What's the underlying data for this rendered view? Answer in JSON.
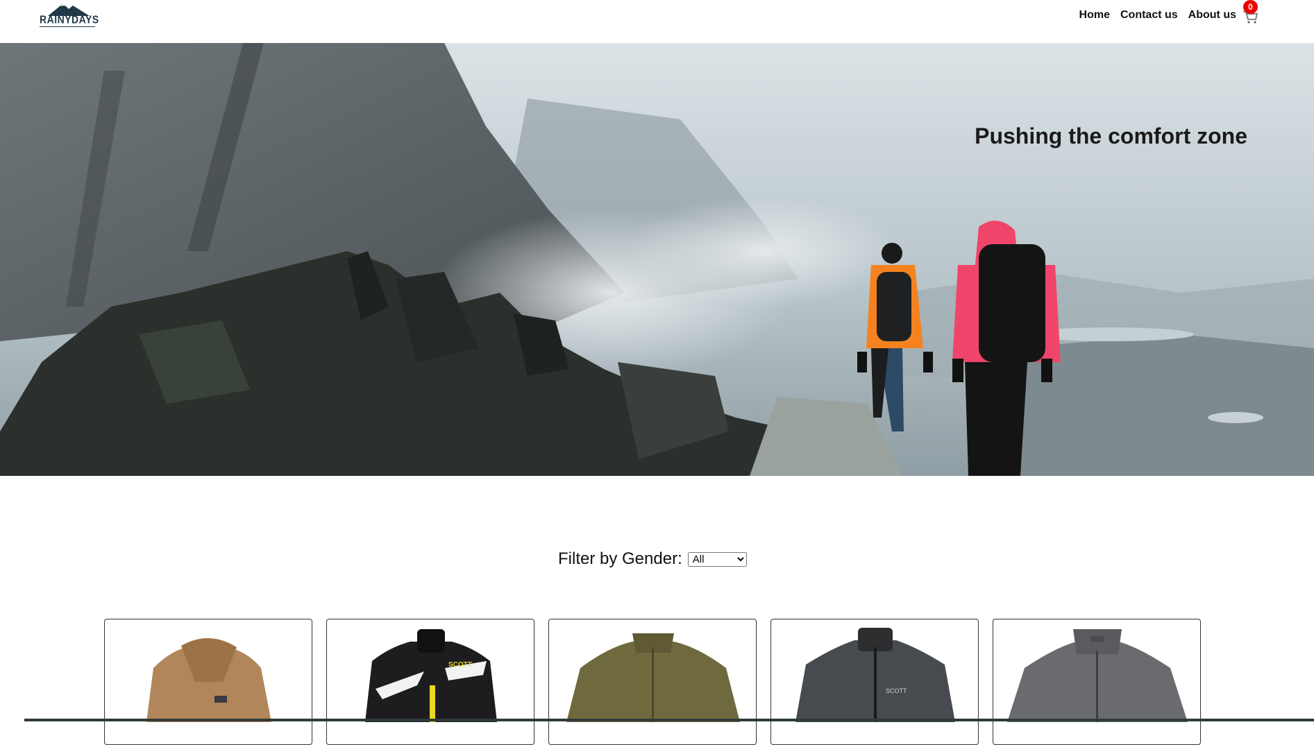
{
  "header": {
    "logo_text": "RAINYDAYS",
    "nav": [
      {
        "label": "Home"
      },
      {
        "label": "Contact us"
      },
      {
        "label": "About us"
      }
    ],
    "cart_count": "0",
    "cart_icon": "cart-icon"
  },
  "hero": {
    "title": "Pushing the comfort zone"
  },
  "filter": {
    "label": "Filter by Gender:",
    "selected": "All",
    "options": [
      "All"
    ]
  },
  "products": [
    {
      "name": "teddy-fleece-jacket",
      "color": "#b0865a"
    },
    {
      "name": "black-scott-ski-jacket",
      "color": "#1d1d1f"
    },
    {
      "name": "olive-fleece-jacket",
      "color": "#6f6a3e"
    },
    {
      "name": "grey-scott-softshell-jacket",
      "color": "#474a4e"
    },
    {
      "name": "grey-rain-jacket",
      "color": "#6a6b6e"
    }
  ],
  "colors": {
    "logo": "#203848",
    "badge": "#ee0000",
    "jacket_orange": "#f5821f",
    "jacket_pink": "#f0456b"
  }
}
